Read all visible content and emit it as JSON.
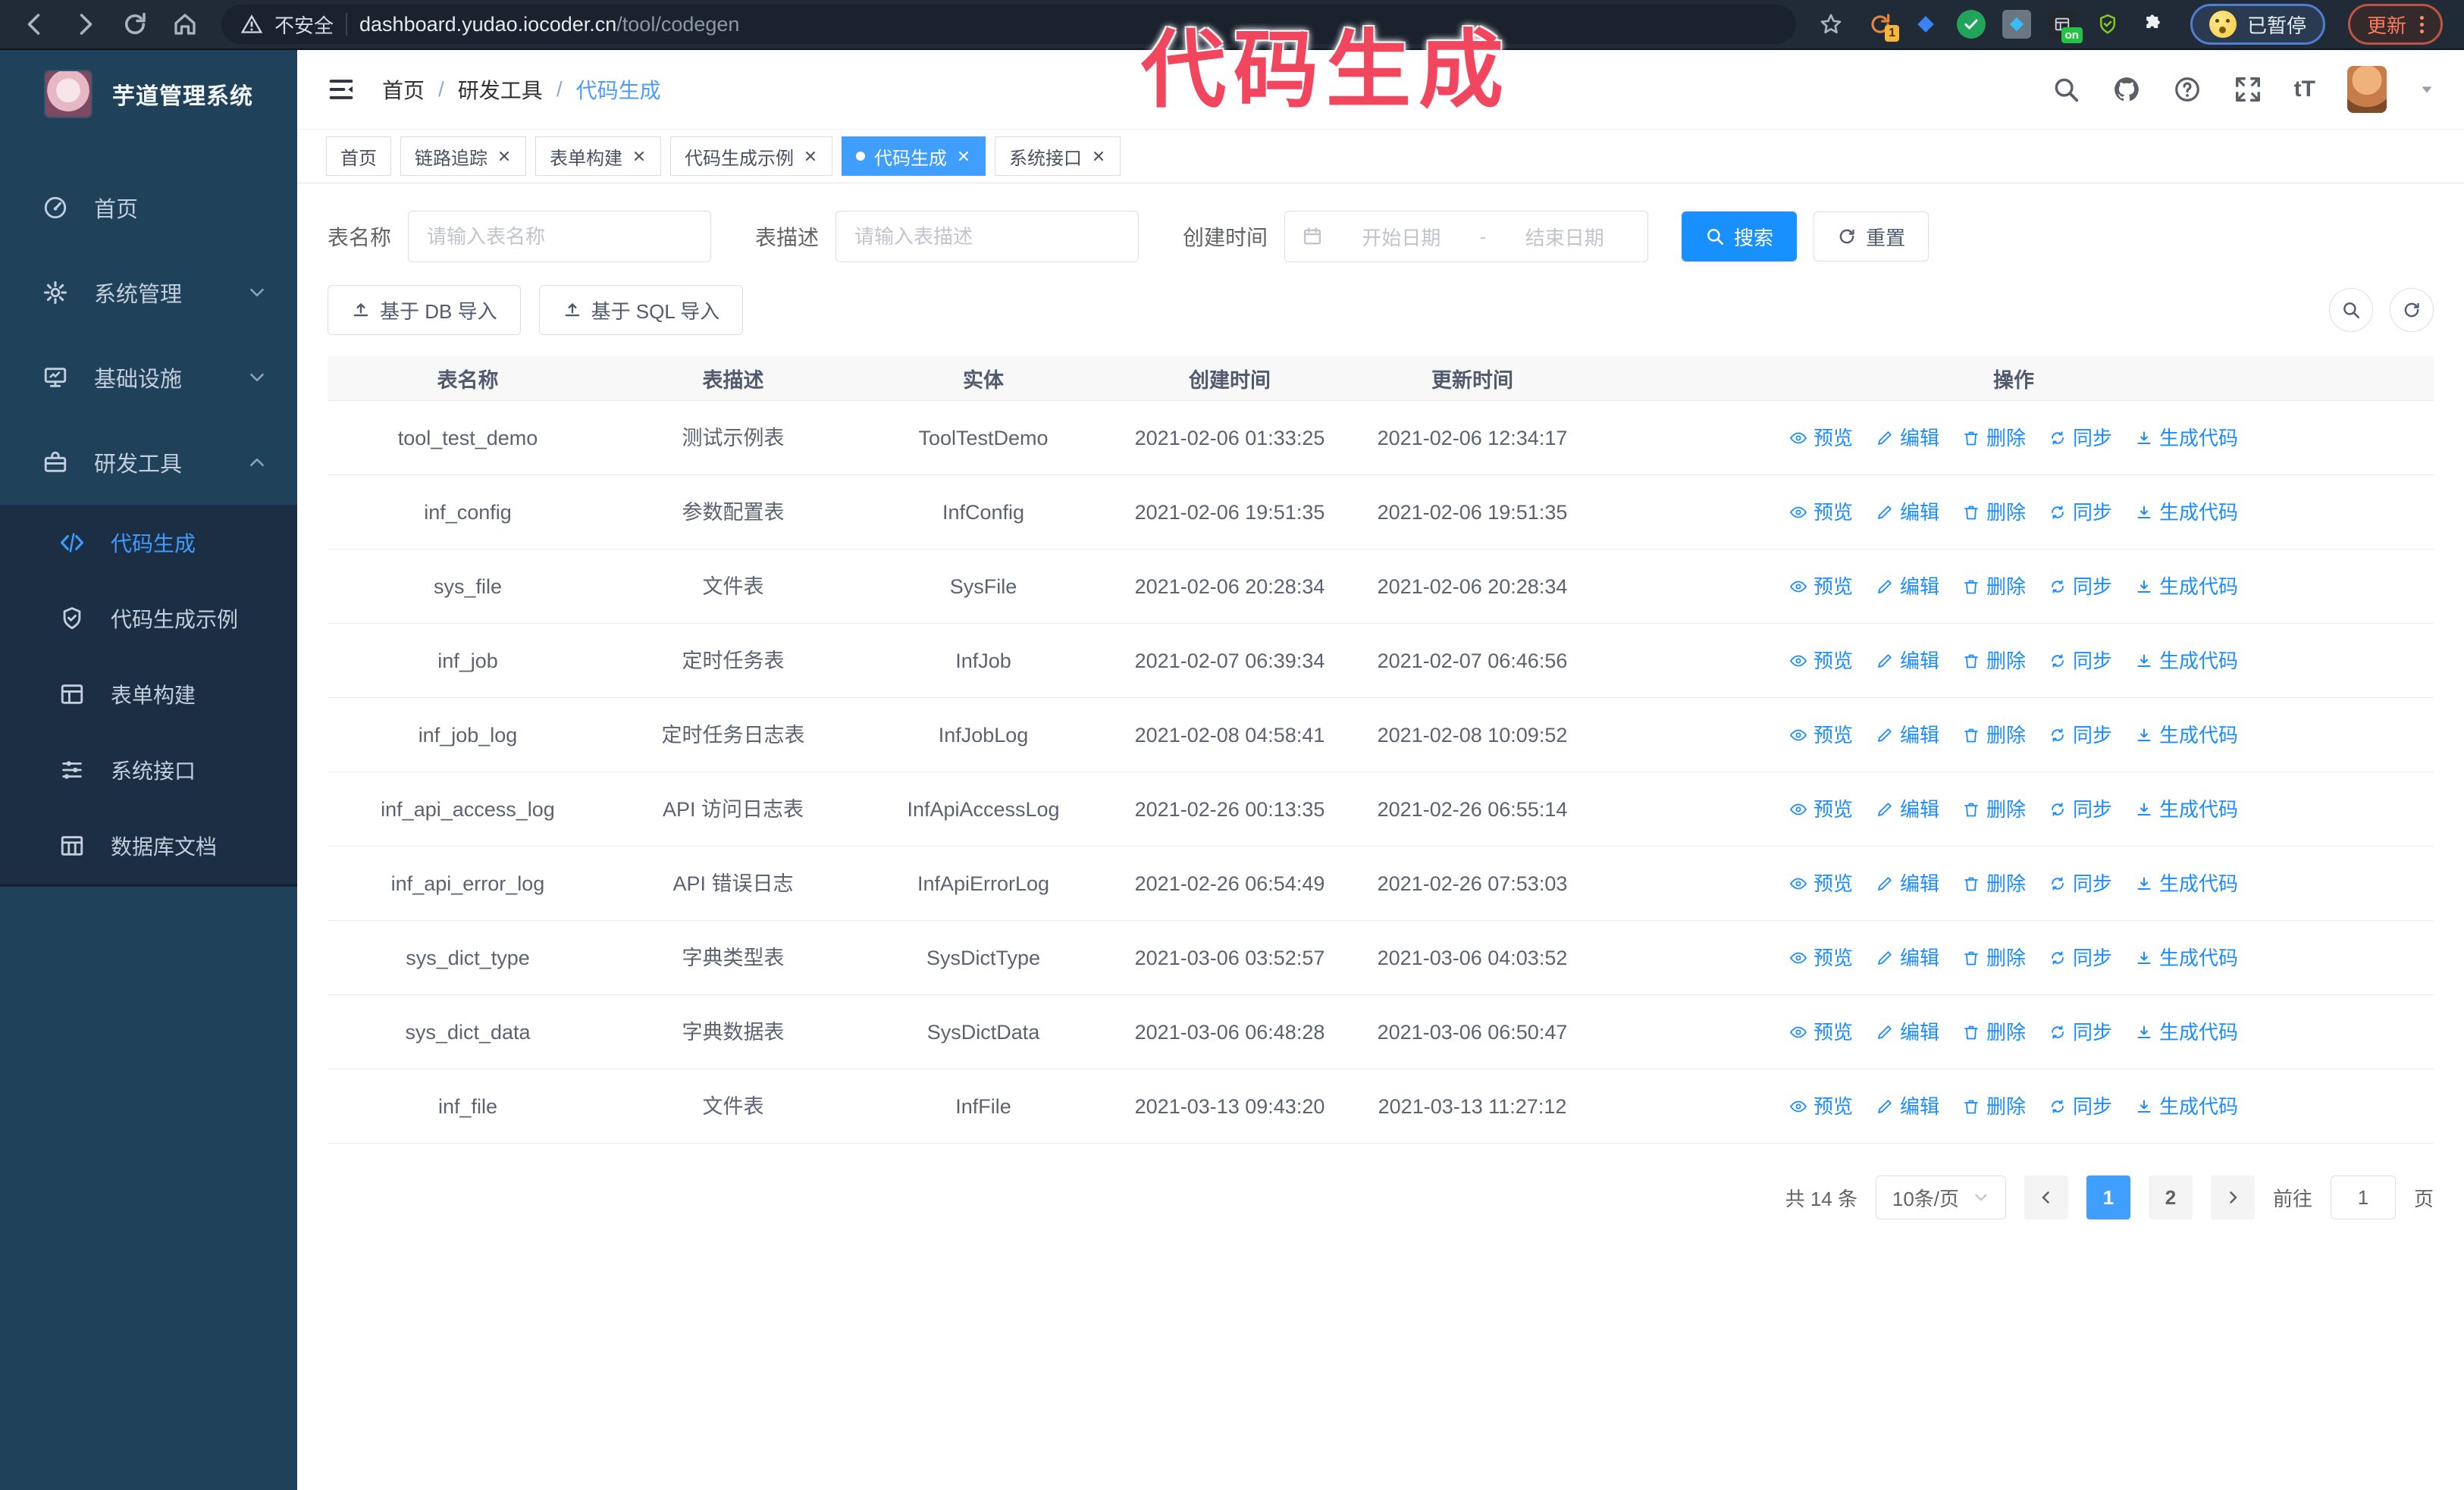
{
  "annotation": {
    "title": "代码生成"
  },
  "browser": {
    "security_label": "不安全",
    "url_host": "dashboard.yudao.iocoder.cn",
    "url_path": "/tool/codegen",
    "extension_on_label": "on",
    "extension_badge": "1",
    "paused_label": "已暂停",
    "update_label": "更新"
  },
  "sidebar": {
    "app_title": "芋道管理系统",
    "items": [
      {
        "label": "首页"
      },
      {
        "label": "系统管理"
      },
      {
        "label": "基础设施"
      },
      {
        "label": "研发工具"
      }
    ],
    "subitems": [
      {
        "label": "代码生成"
      },
      {
        "label": "代码生成示例"
      },
      {
        "label": "表单构建"
      },
      {
        "label": "系统接口"
      },
      {
        "label": "数据库文档"
      }
    ]
  },
  "header": {
    "separator": "/",
    "crumbs": [
      "首页",
      "研发工具",
      "代码生成"
    ]
  },
  "tabs": [
    {
      "label": "首页"
    },
    {
      "label": "链路追踪"
    },
    {
      "label": "表单构建"
    },
    {
      "label": "代码生成示例"
    },
    {
      "label": "代码生成"
    },
    {
      "label": "系统接口"
    }
  ],
  "filters": {
    "name_label": "表名称",
    "name_placeholder": "请输入表名称",
    "desc_label": "表描述",
    "desc_placeholder": "请输入表描述",
    "time_label": "创建时间",
    "start_placeholder": "开始日期",
    "range_separator": "-",
    "end_placeholder": "结束日期",
    "search_label": "搜索",
    "reset_label": "重置"
  },
  "toolbar": {
    "db_import_label": "基于 DB 导入",
    "sql_import_label": "基于 SQL 导入"
  },
  "table": {
    "columns": [
      "表名称",
      "表描述",
      "实体",
      "创建时间",
      "更新时间",
      "操作"
    ],
    "actions": [
      "预览",
      "编辑",
      "删除",
      "同步",
      "生成代码"
    ],
    "rows": [
      {
        "name": "tool_test_demo",
        "description": "测试示例表",
        "entity": "ToolTestDemo",
        "create_time": "2021-02-06 01:33:25",
        "update_time": "2021-02-06 12:34:17"
      },
      {
        "name": "inf_config",
        "description": "参数配置表",
        "entity": "InfConfig",
        "create_time": "2021-02-06 19:51:35",
        "update_time": "2021-02-06 19:51:35"
      },
      {
        "name": "sys_file",
        "description": "文件表",
        "entity": "SysFile",
        "create_time": "2021-02-06 20:28:34",
        "update_time": "2021-02-06 20:28:34"
      },
      {
        "name": "inf_job",
        "description": "定时任务表",
        "entity": "InfJob",
        "create_time": "2021-02-07 06:39:34",
        "update_time": "2021-02-07 06:46:56"
      },
      {
        "name": "inf_job_log",
        "description": "定时任务日志表",
        "entity": "InfJobLog",
        "create_time": "2021-02-08 04:58:41",
        "update_time": "2021-02-08 10:09:52"
      },
      {
        "name": "inf_api_access_log",
        "description": "API 访问日志表",
        "entity": "InfApiAccessLog",
        "create_time": "2021-02-26 00:13:35",
        "update_time": "2021-02-26 06:55:14"
      },
      {
        "name": "inf_api_error_log",
        "description": "API 错误日志",
        "entity": "InfApiErrorLog",
        "create_time": "2021-02-26 06:54:49",
        "update_time": "2021-02-26 07:53:03"
      },
      {
        "name": "sys_dict_type",
        "description": "字典类型表",
        "entity": "SysDictType",
        "create_time": "2021-03-06 03:52:57",
        "update_time": "2021-03-06 04:03:52"
      },
      {
        "name": "sys_dict_data",
        "description": "字典数据表",
        "entity": "SysDictData",
        "create_time": "2021-03-06 06:48:28",
        "update_time": "2021-03-06 06:50:47"
      },
      {
        "name": "inf_file",
        "description": "文件表",
        "entity": "InfFile",
        "create_time": "2021-03-13 09:43:20",
        "update_time": "2021-03-13 11:27:12"
      }
    ]
  },
  "pagination": {
    "total_label": "共 14 条",
    "page_size_label": "10条/页",
    "pages": [
      "1",
      "2"
    ],
    "goto_label": "前往",
    "goto_value": "1",
    "page_suffix": "页"
  }
}
